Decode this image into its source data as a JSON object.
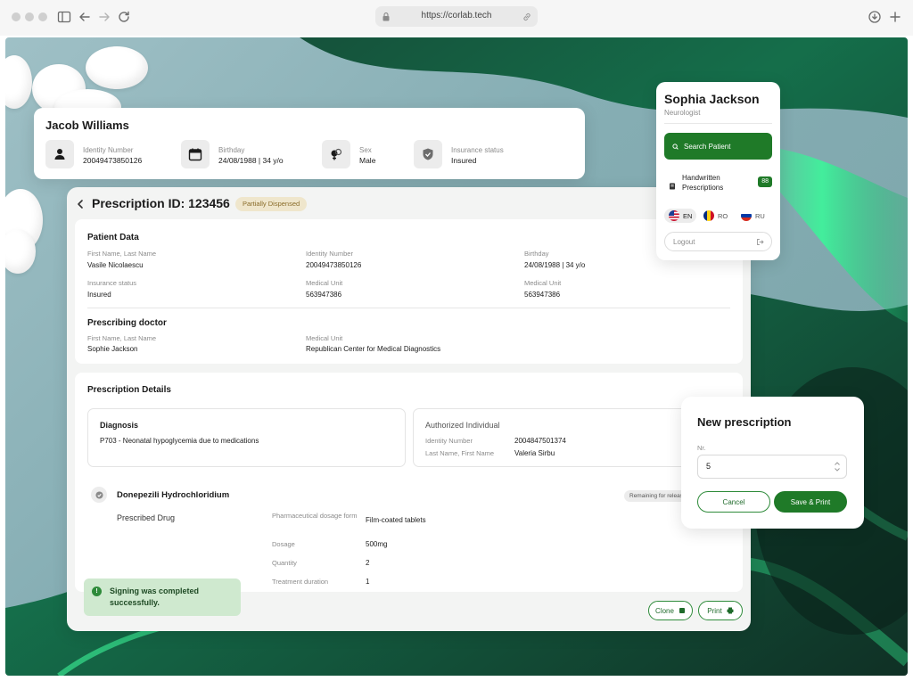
{
  "browser": {
    "url": "https://corlab.tech"
  },
  "patient_header": {
    "name": "Jacob Williams",
    "identity_label": "Identity Number",
    "identity_value": "20049473850126",
    "birthday_label": "Birthday",
    "birthday_value": "24/08/1988 | 34 y/o",
    "sex_label": "Sex",
    "sex_value": "Male",
    "insurance_label": "Insurance status",
    "insurance_value": "Insured"
  },
  "prescription": {
    "title": "Prescription ID: 123456",
    "status_badge": "Partially Dispensed",
    "patient_data": {
      "heading": "Patient Data",
      "name_label": "First Name, Last Name",
      "name_value": "Vasile Nicolaescu",
      "identity_label": "Identity Number",
      "identity_value": "20049473850126",
      "birthday_label": "Birthday",
      "birthday_value": "24/08/1988 | 34 y/o",
      "insurance_label": "Insurance status",
      "insurance_value": "Insured",
      "medical_unit_label": "Medical Unit",
      "medical_unit_value": "563947386",
      "medical_unit2_label": "Medical Unit",
      "medical_unit2_value": "563947386"
    },
    "prescribing_doctor": {
      "heading": "Prescribing doctor",
      "name_label": "First Name, Last Name",
      "name_value": "Sophie Jackson",
      "unit_label": "Medical Unit",
      "unit_value": "Republican Center for Medical Diagnostics"
    },
    "details": {
      "heading": "Prescription Details",
      "diagnosis_heading": "Diagnosis",
      "diagnosis_value": "P703 - Neonatal hypoglycemia due to medications",
      "authorized_heading": "Authorized Individual",
      "auth_identity_label": "Identity Number",
      "auth_identity_value": "2004847501374",
      "auth_name_label": "Last Name, First Name",
      "auth_name_value": "Valeria Sirbu"
    },
    "drug": {
      "name": "Donepezili Hydrochloridium",
      "remaining_badge": "Remaining for release",
      "prescribed_label": "Prescribed Drug",
      "form_label": "Pharmaceutical dosage form",
      "form_value": "Film-coated tablets",
      "dosage_label": "Dosage",
      "dosage_value": "500mg",
      "quantity_label": "Quantity",
      "quantity_value": "2",
      "duration_label": "Treatment duration",
      "duration_value": "1"
    },
    "toast": "Signing was completed successfully.",
    "clone_label": "Clone",
    "print_label": "Print"
  },
  "doctor_menu": {
    "name": "Sophia Jackson",
    "role": "Neurologist",
    "search_label": "Search Patient",
    "handwritten_label": "Handwritten Prescriptions",
    "handwritten_count": "88",
    "languages": [
      "EN",
      "RO",
      "RU"
    ],
    "logout_label": "Logout"
  },
  "new_prescription": {
    "title": "New prescription",
    "nr_label": "Nr.",
    "nr_value": "5",
    "cancel_label": "Cancel",
    "save_label": "Save & Print"
  },
  "colors": {
    "brand_green": "#1f7a28",
    "badge_bg": "#efe6cc",
    "toast_bg": "#cfe9cf"
  }
}
